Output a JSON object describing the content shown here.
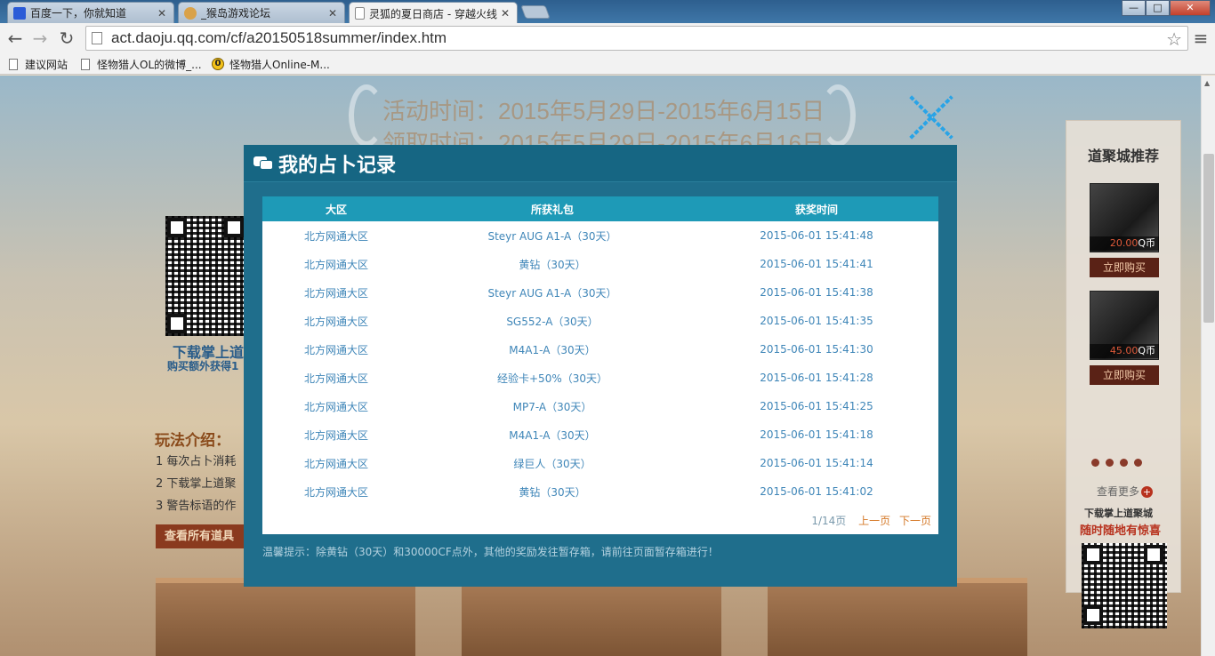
{
  "browser": {
    "tabs": [
      {
        "title": "百度一下，你就知道",
        "favicon": "baidu-paw-icon"
      },
      {
        "title": "_猴岛游戏论坛",
        "favicon": "monkey-icon"
      },
      {
        "title": "灵狐的夏日商店 - 穿越火线",
        "favicon": "page-icon"
      }
    ],
    "window_controls": {
      "minimize": "—",
      "maximize": "□",
      "close": "✕"
    },
    "url": "act.daoju.qq.com/cf/a20150518summer/index.htm",
    "bookmarks": [
      "建议网站",
      "怪物猎人OL的微博_...",
      "怪物猎人Online-M..."
    ]
  },
  "background": {
    "activity_time": "活动时间：2015年5月29日-2015年6月15日",
    "claim_time": "领取时间：2015年5月29日-2015年6月16日",
    "download_title": "下载掌上道",
    "download_sub": "购买额外获得1",
    "intro_title": "玩法介绍：",
    "intro_lines": [
      "1  每次占卜消耗",
      "2  下载掌上道聚",
      "3  警告标语的作"
    ],
    "view_all_button": "查看所有道具"
  },
  "sidebar": {
    "title": "道聚城推荐",
    "products": [
      {
        "price": "20.00",
        "unit": "Q币",
        "buy_label": "立即购买"
      },
      {
        "price": "45.00",
        "unit": "Q币",
        "buy_label": "立即购买"
      }
    ],
    "see_more": "查看更多",
    "download_line1": "下载掌上道聚城",
    "download_line2": "随时随地有惊喜"
  },
  "modal": {
    "title": "我的占卜记录",
    "columns": [
      "大区",
      "所获礼包",
      "获奖时间"
    ],
    "rows": [
      [
        "北方网通大区",
        "Steyr AUG A1-A（30天）",
        "2015-06-01 15:41:48"
      ],
      [
        "北方网通大区",
        "黄钻（30天）",
        "2015-06-01 15:41:41"
      ],
      [
        "北方网通大区",
        "Steyr AUG A1-A（30天）",
        "2015-06-01 15:41:38"
      ],
      [
        "北方网通大区",
        "SG552-A（30天）",
        "2015-06-01 15:41:35"
      ],
      [
        "北方网通大区",
        "M4A1-A（30天）",
        "2015-06-01 15:41:30"
      ],
      [
        "北方网通大区",
        "经验卡+50%（30天）",
        "2015-06-01 15:41:28"
      ],
      [
        "北方网通大区",
        "MP7-A（30天）",
        "2015-06-01 15:41:25"
      ],
      [
        "北方网通大区",
        "M4A1-A（30天）",
        "2015-06-01 15:41:18"
      ],
      [
        "北方网通大区",
        "绿巨人（30天）",
        "2015-06-01 15:41:14"
      ],
      [
        "北方网通大区",
        "黄钻（30天）",
        "2015-06-01 15:41:02"
      ]
    ],
    "pager": {
      "page": "1/14页",
      "prev": "上一页",
      "next": "下一页"
    },
    "tip": "温馨提示：除黄钻（30天）和30000CF点外，其他的奖励发往暂存箱，请前往页面暂存箱进行！"
  },
  "colors": {
    "modal_bg": "#1f6e8c",
    "table_header": "#1e9ab7",
    "cell_text": "#3f86b8",
    "pager_link": "#d57a2a"
  }
}
